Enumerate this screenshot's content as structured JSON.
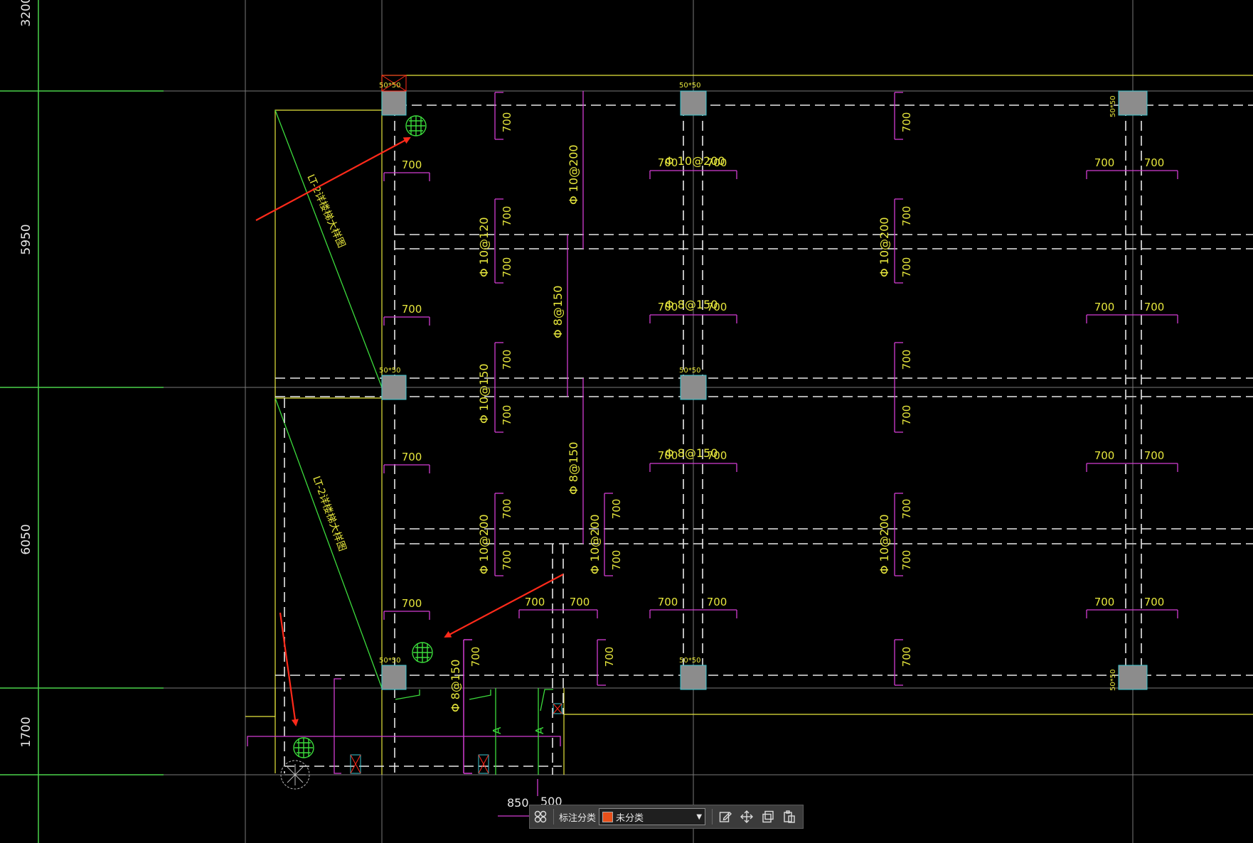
{
  "colors": {
    "background": "#000000",
    "axis_green": "#4ad24a",
    "grid_gray": "#7a7a7a",
    "beam_white": "#e8e8e8",
    "outline_yellow": "#e6e63c",
    "rebar_magenta": "#d23cd2",
    "text_yellow": "#e6e63c",
    "column_fill": "#8c8c8c",
    "column_edge": "#3cc8d2",
    "arrow_red": "#ff2a1a",
    "marker_green": "#3cdc3c"
  },
  "dimensions": {
    "left_axis": [
      "3200",
      "5950",
      "6050",
      "1700"
    ],
    "bottom": [
      "850",
      "500"
    ]
  },
  "column_tags": [
    "50*50",
    "50*50",
    "50*50",
    "50*50",
    "50*50",
    "50*50",
    "50*50",
    "50*50"
  ],
  "rebar_lengths": {
    "value": "700"
  },
  "rebar_specs": [
    "Φ 10@200",
    "Φ 10@200",
    "Φ 10@120",
    "Φ 10@200",
    "Φ 8@150",
    "Φ 8@150",
    "Φ 10@150",
    "Φ 8@150",
    "Φ 8@150",
    "Φ 10@200",
    "Φ 10@200",
    "Φ 10@200",
    "Φ 8@150"
  ],
  "stair_notes": [
    "LT-2详楼梯大样图",
    "LT-2详楼梯大样图"
  ],
  "section_marks": [
    "A",
    "A"
  ],
  "toolbar": {
    "category_label": "标注分类",
    "category_value": "未分类",
    "category_swatch": "#e8501a",
    "icons": [
      "grid-cluster-icon",
      "edit-icon",
      "move-icon",
      "copy-icon",
      "paste-icon"
    ]
  }
}
